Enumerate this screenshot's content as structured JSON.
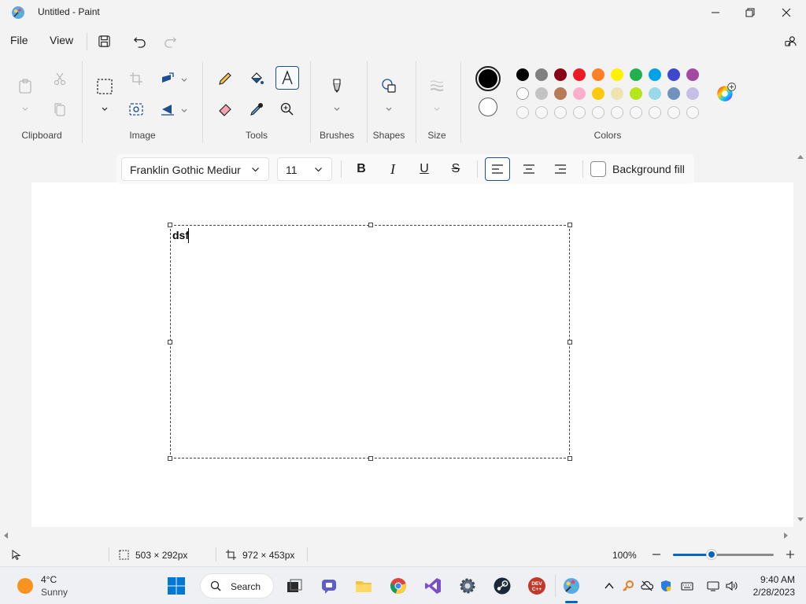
{
  "window": {
    "title": "Untitled - Paint"
  },
  "menu": {
    "file": "File",
    "view": "View"
  },
  "ribbon": {
    "groups": {
      "clipboard": "Clipboard",
      "image": "Image",
      "tools": "Tools",
      "brushes": "Brushes",
      "shapes": "Shapes",
      "size": "Size",
      "colors": "Colors"
    },
    "colors": {
      "primary": "#000000",
      "secondary": "#ffffff",
      "palette_row1": [
        "#000000",
        "#7f7f7f",
        "#880015",
        "#ed1c24",
        "#ff7f27",
        "#fff200",
        "#22b14c",
        "#00a2e8",
        "#3f48cc",
        "#a349a4"
      ],
      "palette_row2": [
        "#ffffff",
        "#c3c3c3",
        "#b97a57",
        "#ffaec9",
        "#ffc90e",
        "#efe4b0",
        "#b5e61d",
        "#99d9ea",
        "#7092be",
        "#c8bfe7"
      ]
    }
  },
  "text_toolbar": {
    "font": "Franklin Gothic Mediur",
    "size": "11",
    "bold": "B",
    "italic": "I",
    "underline": "U",
    "strike": "S",
    "background_fill": "Background fill"
  },
  "canvas": {
    "typed_text": "dsf"
  },
  "status": {
    "selection_size": "503 × 292px",
    "canvas_size": "972 × 453px",
    "zoom": "100%"
  },
  "taskbar": {
    "weather_temp": "4°C",
    "weather_desc": "Sunny",
    "search": "Search",
    "dev_badge": "DEV\nC++",
    "time": "9:40 AM",
    "date": "2/28/2023"
  }
}
